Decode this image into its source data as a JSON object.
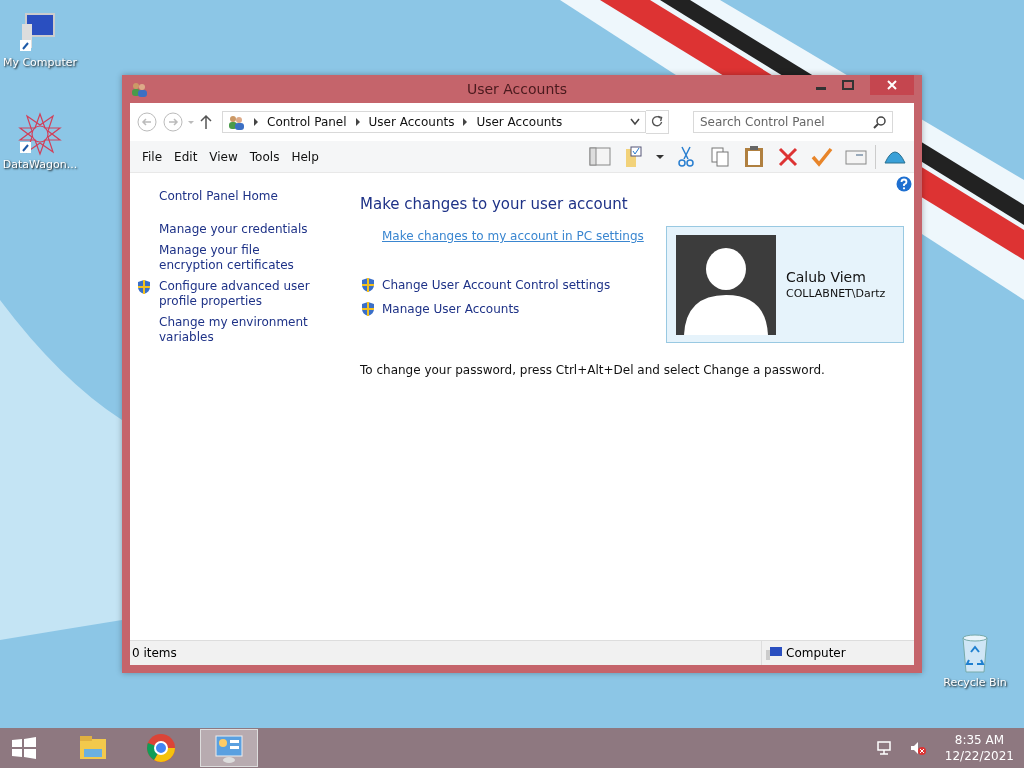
{
  "desktop_icons": [
    {
      "label": "My Computer",
      "kind": "computer"
    },
    {
      "label": "DataWagon...",
      "kind": "star"
    },
    {
      "label": "Recycle Bin",
      "kind": "bin"
    }
  ],
  "window": {
    "title": "User Accounts",
    "breadcrumb": [
      "Control Panel",
      "User Accounts",
      "User Accounts"
    ],
    "search": {
      "placeholder": "Search Control Panel"
    },
    "menu": [
      "File",
      "Edit",
      "View",
      "Tools",
      "Help"
    ],
    "sidebar": [
      {
        "label": "Control Panel Home",
        "shield": false
      },
      {
        "label": "Manage your credentials",
        "shield": false
      },
      {
        "label": "Manage your file encryption certificates",
        "shield": false
      },
      {
        "label": "Configure advanced user profile properties",
        "shield": true
      },
      {
        "label": "Change my environment variables",
        "shield": false
      }
    ],
    "heading": "Make changes to your user account",
    "pc_settings_link": "Make changes to my account in PC settings",
    "tasks": [
      {
        "label": "Change User Account Control settings",
        "shield": true
      },
      {
        "label": "Manage User Accounts",
        "shield": true
      }
    ],
    "user": {
      "name": "Calub Viem",
      "account": "COLLABNET\\Dartz"
    },
    "note": "To change your password, press Ctrl+Alt+Del and select Change a password.",
    "status_bar": {
      "items": "0 items",
      "location": "Computer"
    }
  },
  "taskbar": {
    "apps": [
      {
        "kind": "explorer",
        "selected": false
      },
      {
        "kind": "chrome",
        "selected": false
      },
      {
        "kind": "control",
        "selected": true
      }
    ],
    "time": "8:35 AM",
    "date": "12/22/2021"
  }
}
